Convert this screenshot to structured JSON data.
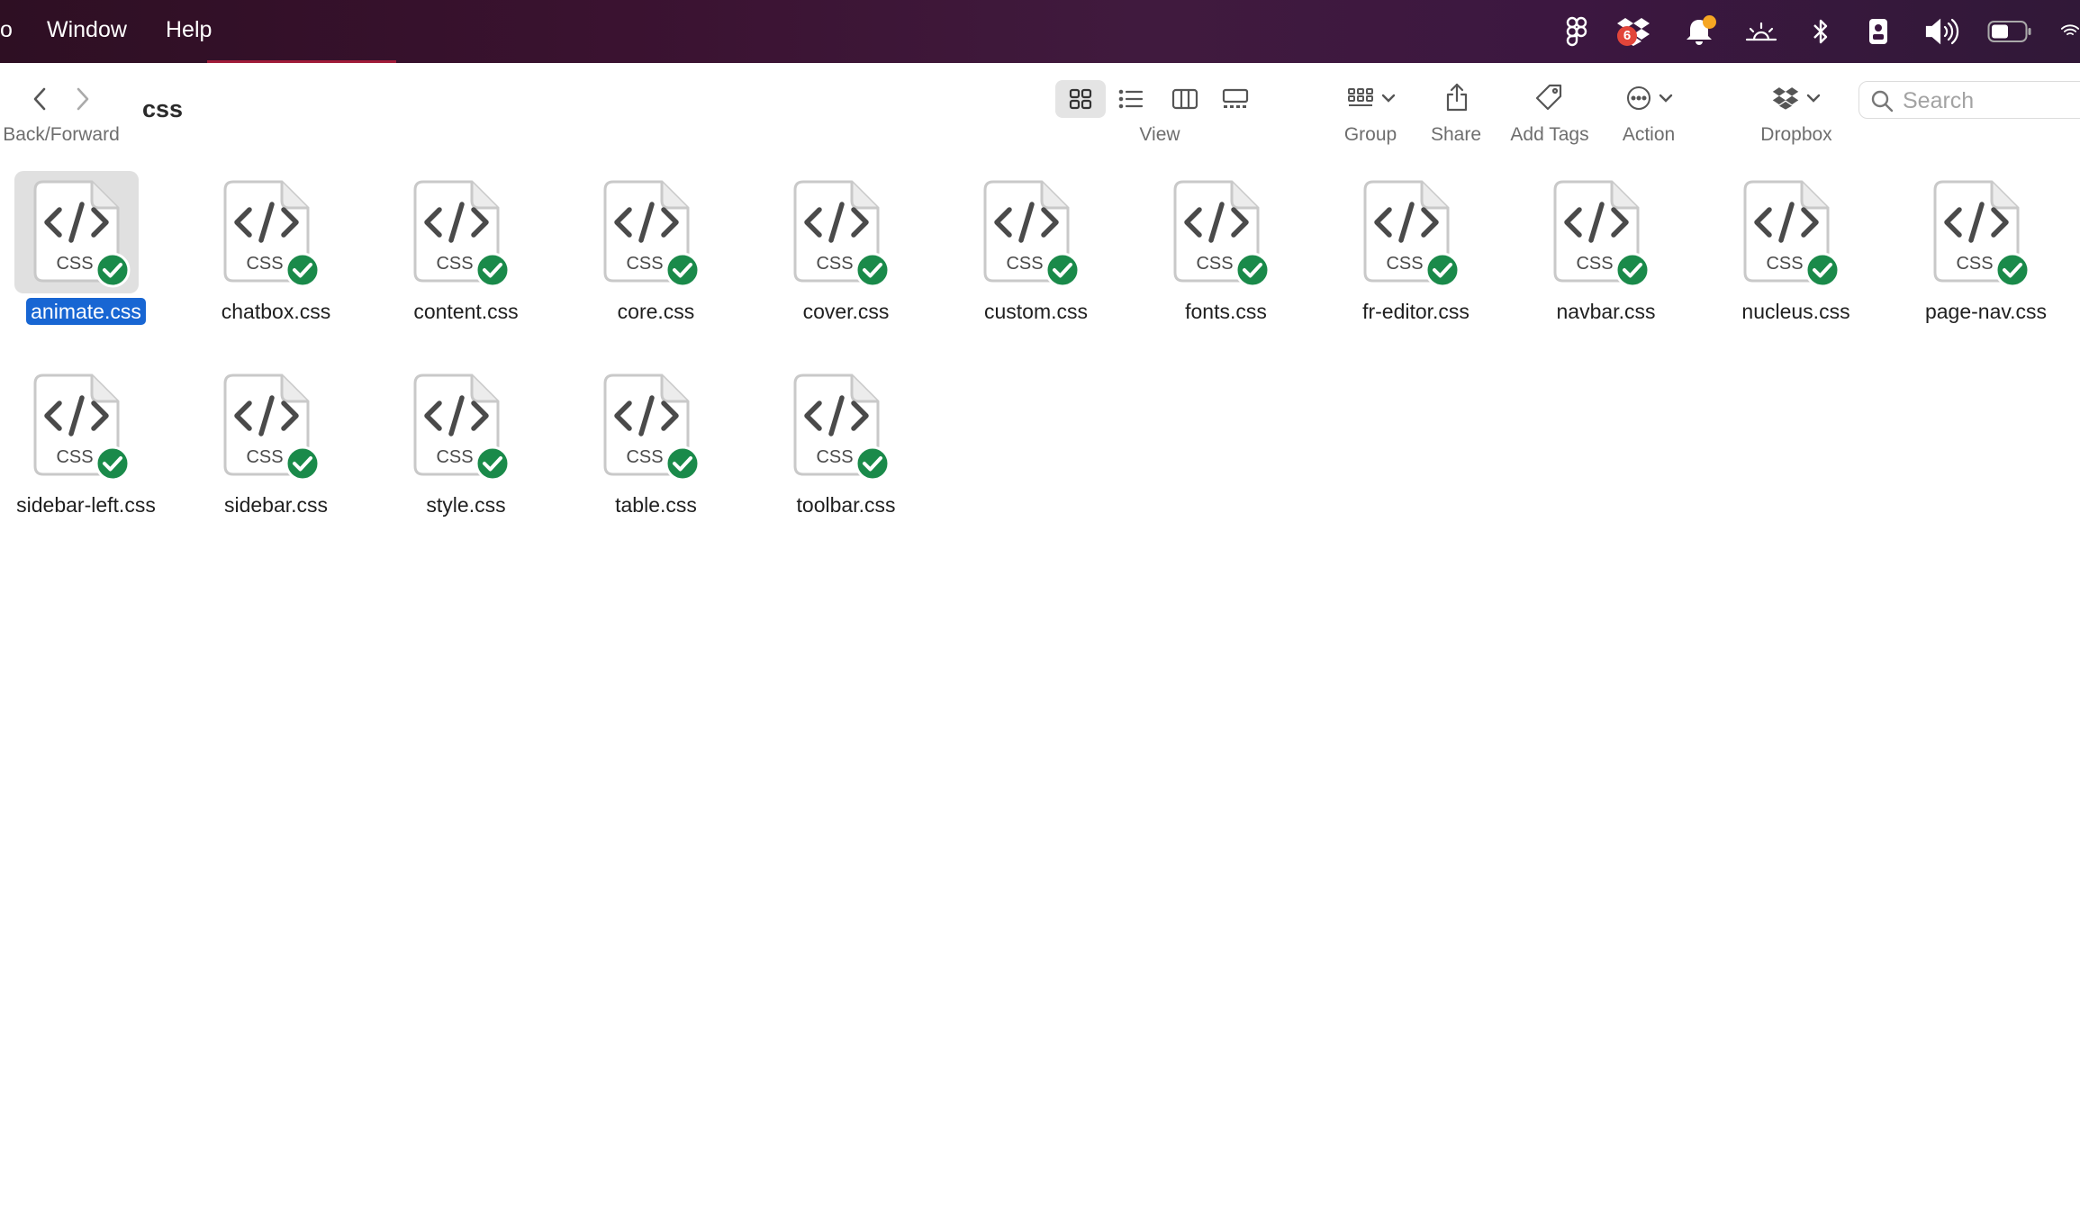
{
  "menubar": {
    "items": [
      "o",
      "Window",
      "Help"
    ],
    "status_icons": [
      "figma-icon",
      "dropbox-icon",
      "notification-bell-icon",
      "brightness-icon",
      "bluetooth-icon",
      "id-badge-icon",
      "volume-icon",
      "battery-icon",
      "wifi-icon"
    ],
    "dropbox_badge": "6"
  },
  "toolbar": {
    "back_forward_label": "Back/Forward",
    "folder_title": "css",
    "view_label": "View",
    "group_label": "Group",
    "share_label": "Share",
    "add_tags_label": "Add Tags",
    "action_label": "Action",
    "dropbox_label": "Dropbox",
    "search_placeholder": "Search"
  },
  "files": [
    {
      "name": "animate.css",
      "selected": true
    },
    {
      "name": "chatbox.css"
    },
    {
      "name": "content.css"
    },
    {
      "name": "core.css"
    },
    {
      "name": "cover.css"
    },
    {
      "name": "custom.css"
    },
    {
      "name": "fonts.css"
    },
    {
      "name": "fr-editor.css"
    },
    {
      "name": "navbar.css"
    },
    {
      "name": "nucleus.css"
    },
    {
      "name": "page-nav.css"
    },
    {
      "name": "sidebar-left.css"
    },
    {
      "name": "sidebar.css"
    },
    {
      "name": "style.css"
    },
    {
      "name": "table.css"
    },
    {
      "name": "toolbar.css"
    }
  ],
  "file_icon_text": "CSS",
  "colors": {
    "selection": "#1866d3",
    "sync_check": "#1a8a4a",
    "menubar": "#3a1230"
  }
}
